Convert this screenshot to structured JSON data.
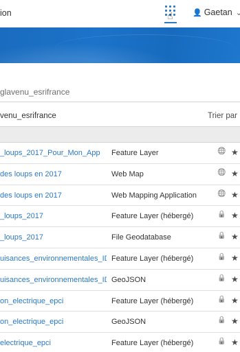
{
  "topbar": {
    "left_text": "ion",
    "apps_icon": "grid-dots-icon",
    "user_name": "Gaetan",
    "user_icon": "user-icon",
    "chevron": "chevron-down-icon",
    "accent": "#2c79c4"
  },
  "search": {
    "value": "glavenu_esrifrance"
  },
  "list_header": {
    "owner": "venu_esrifrance",
    "sort_label": "Trier par"
  },
  "rows": [
    {
      "name": "_loups_2017_Pour_Mon_App",
      "type": "Feature Layer",
      "sharing": "public"
    },
    {
      "name": "des loups en 2017",
      "type": "Web Map",
      "sharing": "public"
    },
    {
      "name": "des loups en 2017",
      "type": "Web Mapping Application",
      "sharing": "public"
    },
    {
      "name": "_loups_2017",
      "type": "Feature Layer (hébergé)",
      "sharing": "private"
    },
    {
      "name": "_loups_2017",
      "type": "File Geodatabase",
      "sharing": "private"
    },
    {
      "name": "uisances_environnementales_IDF",
      "type": "Feature Layer (hébergé)",
      "sharing": "private"
    },
    {
      "name": "uisances_environnementales_IDF",
      "type": "GeoJSON",
      "sharing": "private"
    },
    {
      "name": "on_electrique_epci",
      "type": "Feature Layer (hébergé)",
      "sharing": "private"
    },
    {
      "name": "on_electrique_epci",
      "type": "GeoJSON",
      "sharing": "private"
    },
    {
      "name": "electrique_epci",
      "type": "Feature Layer (hébergé)",
      "sharing": "private"
    }
  ]
}
